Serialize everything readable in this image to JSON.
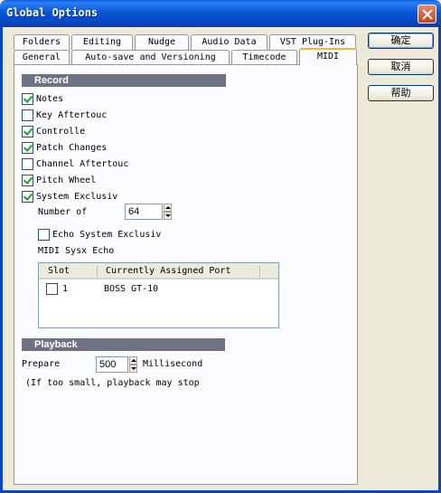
{
  "window": {
    "title": "Global Options"
  },
  "tabs_row1": [
    "Folders",
    "Editing",
    "Nudge",
    "Audio Data",
    "VST Plug-Ins"
  ],
  "tabs_row2": [
    "General",
    "Auto-save and Versioning",
    "Timecode",
    "MIDI"
  ],
  "active_tab": "MIDI",
  "record": {
    "heading": "Record",
    "options": [
      {
        "label": "Notes",
        "checked": true
      },
      {
        "label": "Key Aftertouc",
        "checked": false
      },
      {
        "label": "Controlle",
        "checked": true
      },
      {
        "label": "Patch Changes",
        "checked": true
      },
      {
        "label": "Channel Aftertouc",
        "checked": false
      },
      {
        "label": "Pitch Wheel",
        "checked": true
      },
      {
        "label": "System Exclusiv",
        "checked": true
      }
    ],
    "number_of_label": "Number of",
    "number_of_value": "64",
    "echo_label": "Echo System Exclusiv",
    "echo_checked": false,
    "sysx_echo_label": "MIDI Sysx Echo",
    "table": {
      "columns": [
        "Slot",
        "Currently Assigned Port"
      ],
      "rows": [
        {
          "checked": false,
          "slot": "1",
          "port": "BOSS GT-10"
        }
      ]
    }
  },
  "playback": {
    "heading": "Playback",
    "prepare_label": "Prepare",
    "prepare_value": "500",
    "unit_label": "Millisecond",
    "note": "(If too small, playback may stop"
  },
  "buttons": {
    "ok": "确定",
    "cancel": "取消",
    "help": "帮助"
  },
  "colors": {
    "title_bar": "#0a5fde",
    "section_header": "#6d7383",
    "check_mark": "#21a121"
  }
}
